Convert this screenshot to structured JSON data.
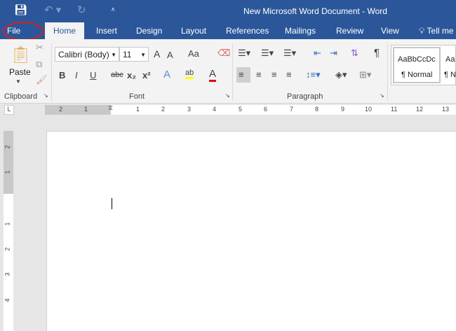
{
  "window": {
    "title": "New Microsoft Word Document - Word"
  },
  "qat": {
    "save_icon": "save-icon",
    "undo_icon": "undo-icon",
    "redo_icon": "redo-icon",
    "customize_icon": "customize-icon"
  },
  "tabs": [
    "File",
    "Home",
    "Insert",
    "Design",
    "Layout",
    "References",
    "Mailings",
    "Review",
    "View"
  ],
  "tell_me": "Tell me",
  "clipboard": {
    "paste": "Paste",
    "label": "Clipboard"
  },
  "font": {
    "name": "Calibri (Body)",
    "size": "11",
    "label": "Font",
    "grow": "A",
    "shrink": "A",
    "case": "Aa",
    "bold": "B",
    "italic": "I",
    "underline": "U",
    "strike": "abc",
    "sub": "x₂",
    "sup": "x²",
    "text_effects": "A",
    "highlight": "ab",
    "font_color": "A",
    "highlight_color": "#ffff00",
    "font_color_value": "#e00000"
  },
  "paragraph": {
    "label": "Paragraph",
    "pilcrow": "¶"
  },
  "styles": [
    {
      "preview": "AaBbCcDc",
      "name": "¶ Normal"
    },
    {
      "preview": "Aa",
      "name": "¶ N"
    }
  ],
  "ruler": {
    "tab_selector": "L",
    "h_left": [
      "2",
      "1"
    ],
    "h_right": [
      "1",
      "2",
      "3",
      "4",
      "5",
      "6",
      "7",
      "8",
      "9",
      "10",
      "11",
      "12",
      "13"
    ],
    "v_top": [
      "2",
      "1"
    ],
    "v_bottom": [
      "1",
      "2",
      "3",
      "4"
    ]
  }
}
